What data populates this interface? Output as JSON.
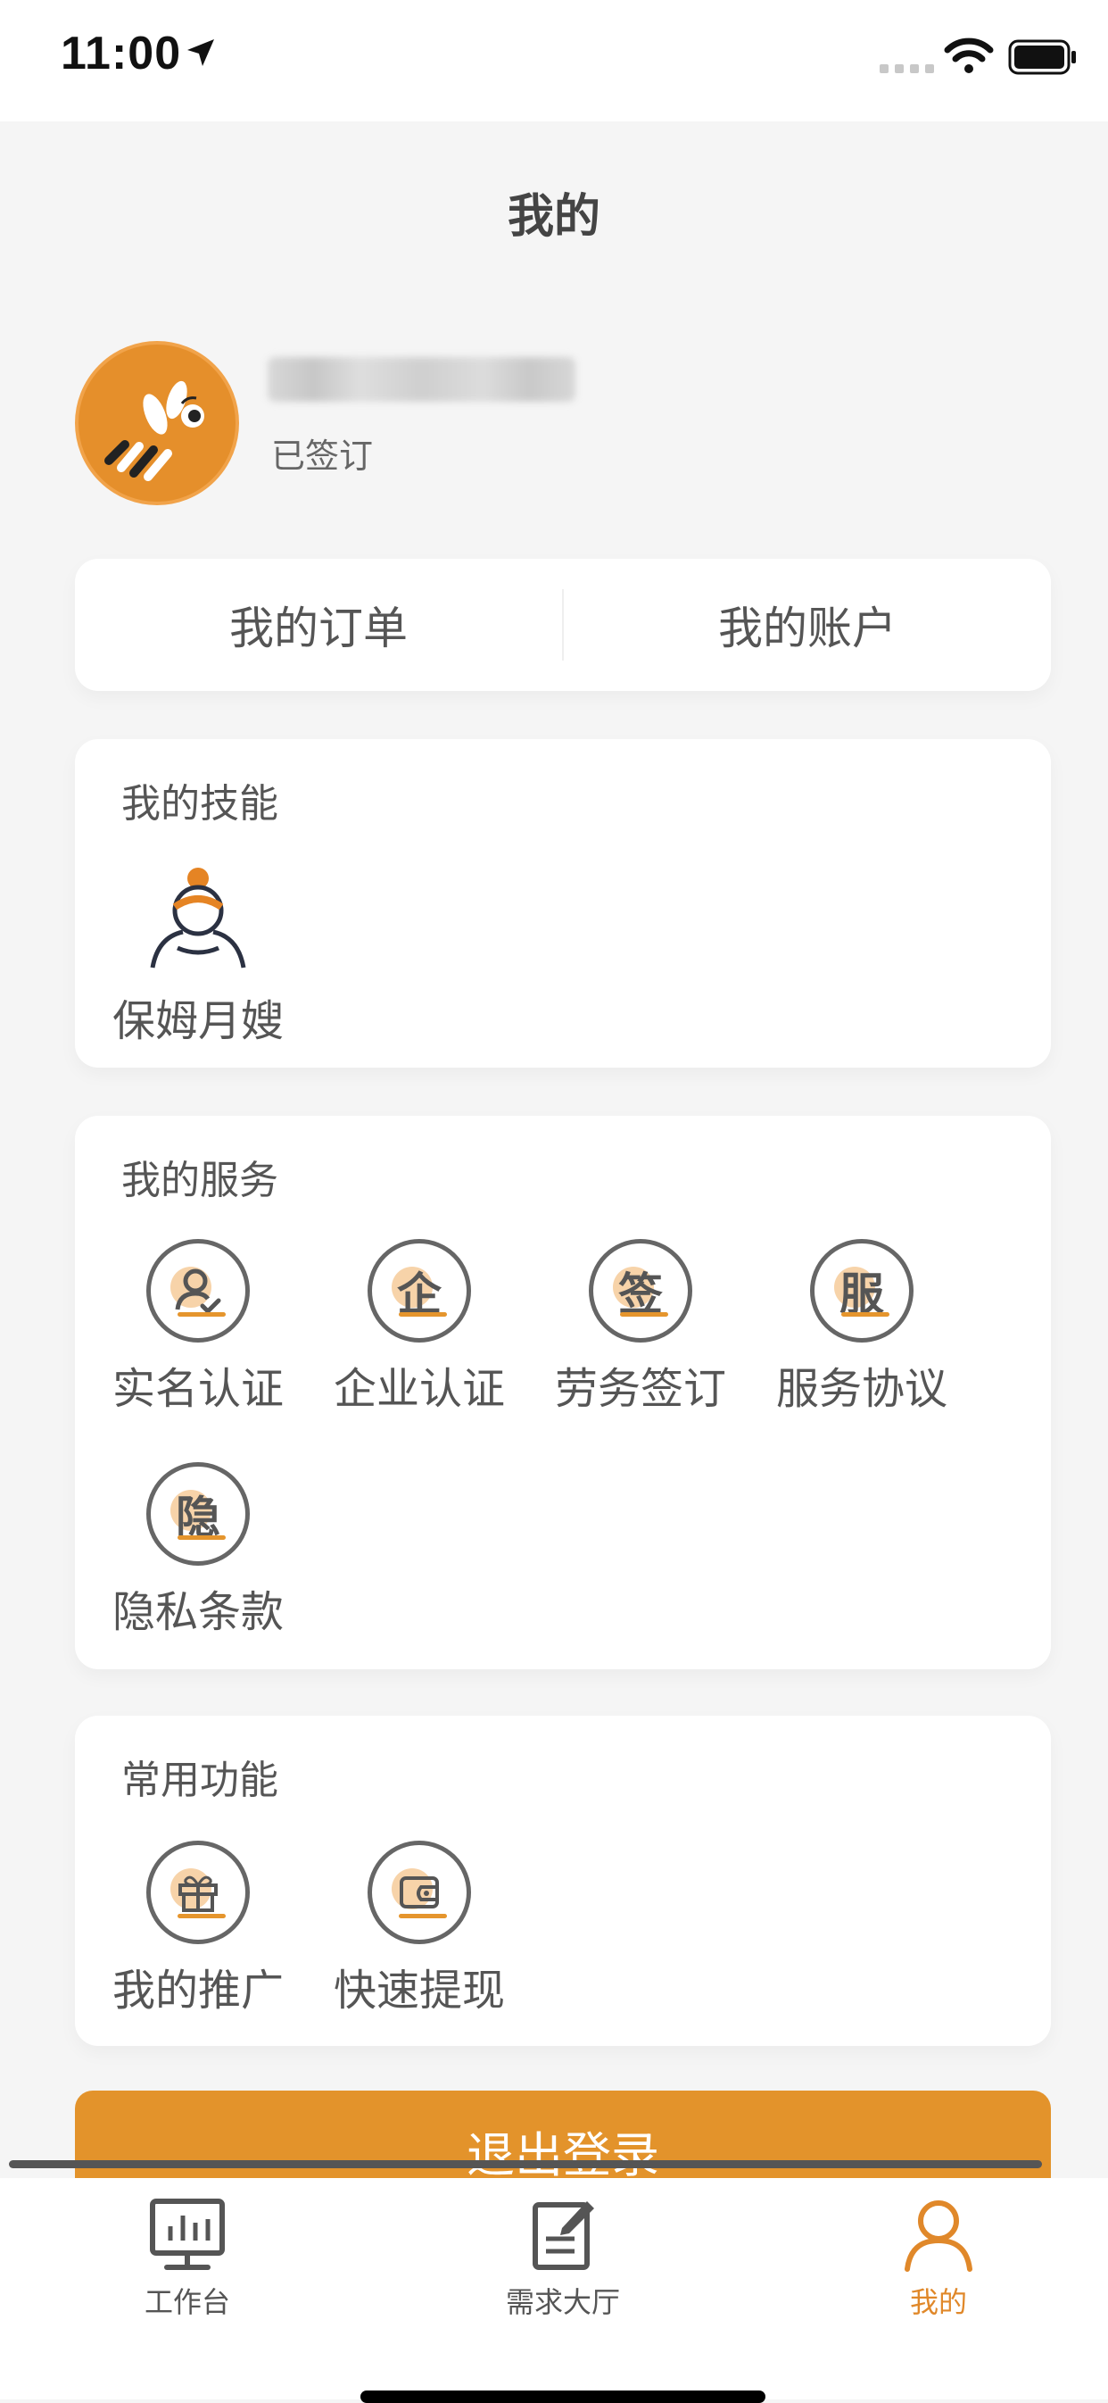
{
  "status_bar": {
    "time": "11:00"
  },
  "header": {
    "title": "我的"
  },
  "profile": {
    "status": "已签订"
  },
  "quick_links": [
    {
      "label": "我的订单"
    },
    {
      "label": "我的账户"
    }
  ],
  "skills": {
    "title": "我的技能",
    "items": [
      {
        "label": "保姆月嫂",
        "icon": "nanny-icon"
      }
    ]
  },
  "services": {
    "title": "我的服务",
    "items": [
      {
        "label": "实名认证",
        "icon": "id-verify-icon"
      },
      {
        "label": "企业认证",
        "icon": "enterprise-icon",
        "glyph": "企"
      },
      {
        "label": "劳务签订",
        "icon": "sign-icon",
        "glyph": "签"
      },
      {
        "label": "服务协议",
        "icon": "service-icon",
        "glyph": "服"
      },
      {
        "label": "隐私条款",
        "icon": "privacy-icon",
        "glyph": "隐"
      }
    ]
  },
  "common": {
    "title": "常用功能",
    "items": [
      {
        "label": "我的推广",
        "icon": "gift-icon"
      },
      {
        "label": "快速提现",
        "icon": "wallet-icon"
      }
    ]
  },
  "logout": {
    "label": "退出登录"
  },
  "tabbar": {
    "items": [
      {
        "label": "工作台",
        "icon": "dashboard-icon"
      },
      {
        "label": "需求大厅",
        "icon": "edit-doc-icon"
      },
      {
        "label": "我的",
        "icon": "user-icon",
        "active": true
      }
    ]
  },
  "colors": {
    "accent": "#e3932b",
    "background": "#f5f5f5",
    "card": "#ffffff"
  }
}
